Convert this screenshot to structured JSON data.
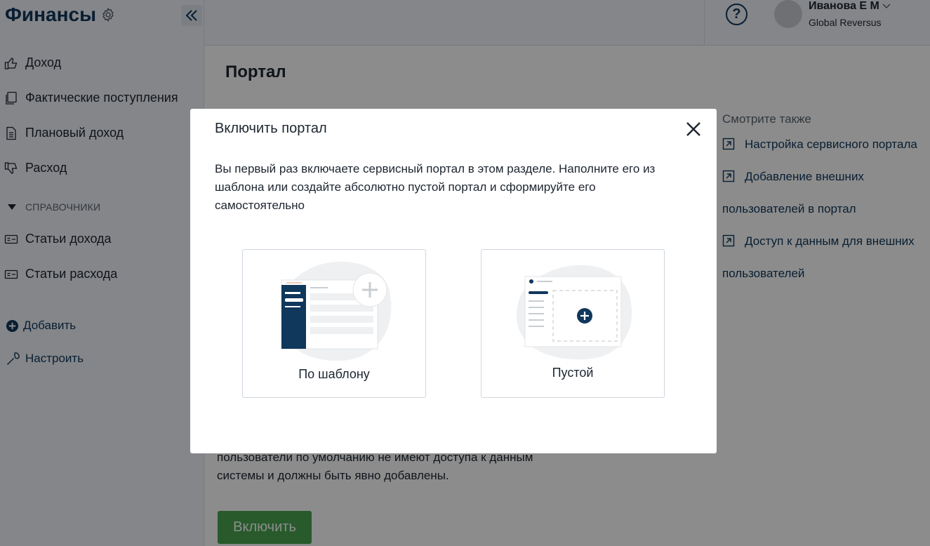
{
  "app": {
    "title": "Финансы"
  },
  "sidebar": {
    "items": [
      {
        "label": "Доход",
        "icon": "thumbs-up-icon"
      },
      {
        "label": "Фактические поступления",
        "icon": "documents-icon"
      },
      {
        "label": "Плановый доход",
        "icon": "document-icon"
      },
      {
        "label": "Расход",
        "icon": "thumbs-down-icon"
      }
    ],
    "group_label": "СПРАВОЧНИКИ",
    "group_items": [
      {
        "label": "Статьи дохода",
        "icon": "card-icon"
      },
      {
        "label": "Статьи расхода",
        "icon": "card-icon"
      }
    ],
    "add_label": "Добавить",
    "configure_label": "Настроить"
  },
  "header": {
    "help_symbol": "?",
    "user_name": "Иванова Е М",
    "user_org": "Global Reversus"
  },
  "main": {
    "title": "Портал",
    "body_line1": "пользователи по умолчанию не имеют доступа к данным",
    "body_line2": "системы и должны быть явно добавлены.",
    "enable_button": "Включить"
  },
  "see_also": {
    "title": "Смотрите также",
    "links": [
      {
        "line1": "Настройка сервисного портала",
        "line2": ""
      },
      {
        "line1": "Добавление внешних",
        "line2": "пользователей в портал"
      },
      {
        "line1": "Доступ к данным для внешних",
        "line2": "пользователей"
      }
    ]
  },
  "modal": {
    "title": "Включить портал",
    "description_line1": "Вы первый раз включаете сервисный портал в этом разделе. Наполните его из",
    "description_line2": "шаблона или создайте абсолютно пустой портал и сформируйте его",
    "description_line3": "самостоятельно",
    "option_template": "По шаблону",
    "option_empty": "Пустой"
  },
  "colors": {
    "brand_navy": "#10375c",
    "accent_green": "#49a550",
    "sidebar_bg": "#f2f5f9",
    "overlay": "rgba(0,0,0,0.45)"
  }
}
